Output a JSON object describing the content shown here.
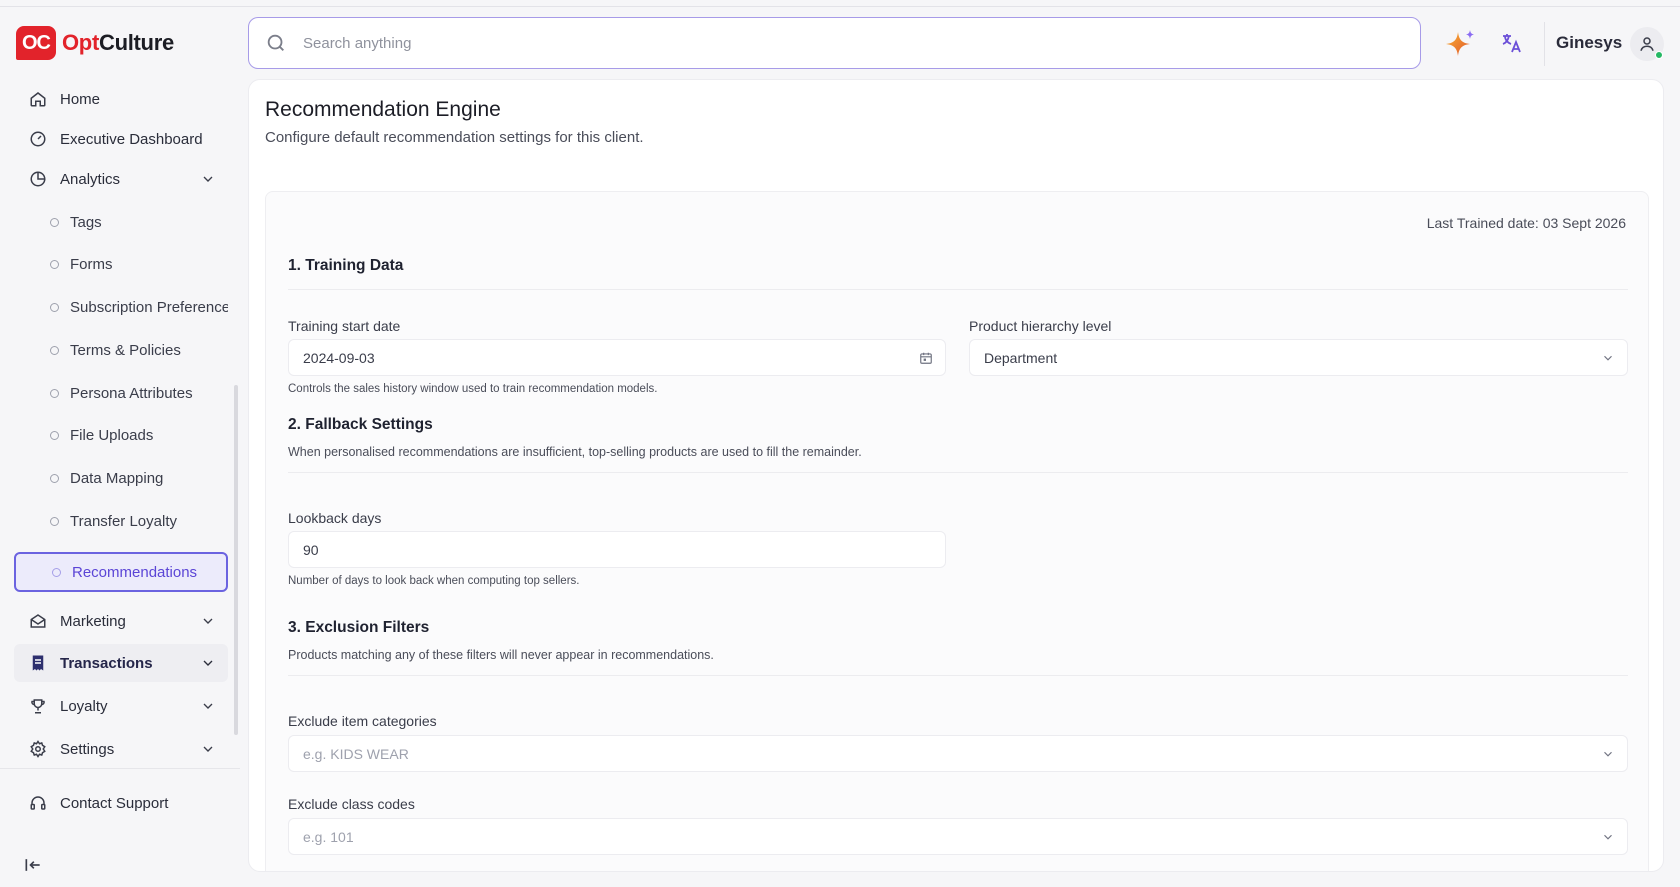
{
  "brand": {
    "mark": "OC",
    "name_part1": "Opt",
    "name_part2": "Culture"
  },
  "search": {
    "placeholder": "Search anything"
  },
  "header": {
    "user_name": "Ginesys"
  },
  "sidebar": {
    "items": [
      {
        "label": "Home",
        "icon": "home-icon"
      },
      {
        "label": "Executive Dashboard",
        "icon": "gauge-icon"
      },
      {
        "label": "Analytics",
        "icon": "pie-chart-icon"
      },
      {
        "label": "Marketing",
        "icon": "mail-open-icon"
      },
      {
        "label": "Transactions",
        "icon": "receipt-icon"
      },
      {
        "label": "Loyalty",
        "icon": "trophy-icon"
      },
      {
        "label": "Settings",
        "icon": "gear-icon"
      },
      {
        "label": "Contact Support",
        "icon": "headset-icon"
      }
    ],
    "sub_items": [
      "Tags",
      "Forms",
      "Subscription Preferences",
      "Terms & Policies",
      "Persona Attributes",
      "File Uploads",
      "Data Mapping",
      "Transfer Loyalty",
      "Recommendations"
    ]
  },
  "page": {
    "title": "Recommendation Engine",
    "subtitle": "Configure default recommendation settings for this client.",
    "last_trained": "Last Trained date: 03 Sept 2026"
  },
  "training": {
    "title": "1. Training Data",
    "start_date_label": "Training start date",
    "start_date_value": "2024-09-03",
    "hierarchy_label": "Product hierarchy level",
    "hierarchy_value": "Department",
    "help": "Controls the sales history window used to train recommendation models."
  },
  "fallback": {
    "title": "2. Fallback Settings",
    "desc": "When personalised recommendations are insufficient, top-selling products are used to fill the remainder.",
    "lookback_label": "Lookback days",
    "lookback_value": "90",
    "help": "Number of days to look back when computing top sellers."
  },
  "exclusion": {
    "title": "3. Exclusion Filters",
    "desc": "Products matching any of these filters will never appear in recommendations.",
    "categories_label": "Exclude item categories",
    "categories_placeholder": "e.g. KIDS WEAR",
    "class_label": "Exclude class codes",
    "class_placeholder": "e.g. 101"
  },
  "colors": {
    "brand_red": "#e2232b",
    "accent_purple": "#6b63e0"
  }
}
